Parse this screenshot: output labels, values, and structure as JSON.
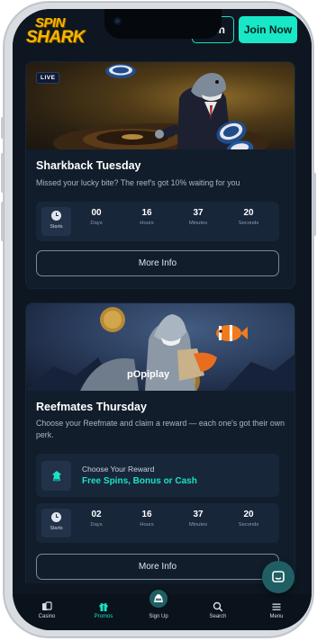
{
  "header": {
    "logo_line1": "SPIN",
    "logo_line2": "SHARK",
    "login_label": "In",
    "join_label": "Join Now"
  },
  "promos": [
    {
      "badge": "LIVE",
      "title": "Sharkback Tuesday",
      "description": "Missed your lucky bite? The reef's got 10% waiting for you",
      "countdown": {
        "starts_label": "Starts",
        "units": [
          {
            "value": "00",
            "label": "Days"
          },
          {
            "value": "16",
            "label": "Hours"
          },
          {
            "value": "37",
            "label": "Minutes"
          },
          {
            "value": "20",
            "label": "Seconds"
          }
        ]
      },
      "more_info_label": "More Info"
    },
    {
      "banner_brand": "pOpiplay",
      "title": "Reefmates Thursday",
      "description": "Choose your Reefmate and claim a reward — each one's got their own perk.",
      "reward": {
        "label": "Choose Your Reward",
        "value": "Free Spins, Bonus or Cash"
      },
      "countdown": {
        "starts_label": "Starts",
        "units": [
          {
            "value": "02",
            "label": "Days"
          },
          {
            "value": "16",
            "label": "Hours"
          },
          {
            "value": "37",
            "label": "Minutes"
          },
          {
            "value": "20",
            "label": "Seconds"
          }
        ]
      },
      "more_info_label": "More Info"
    }
  ],
  "bottom_nav": [
    {
      "label": "Casino",
      "icon": "cards-icon"
    },
    {
      "label": "Promos",
      "icon": "gift-icon",
      "active": true
    },
    {
      "label": "Sign Up",
      "icon": "shark-icon"
    },
    {
      "label": "Search",
      "icon": "search-icon"
    },
    {
      "label": "Menu",
      "icon": "menu-icon"
    }
  ],
  "colors": {
    "accent": "#19e3c4",
    "background": "#0d1621",
    "card": "#111d2b",
    "logo": "#f5b700"
  }
}
